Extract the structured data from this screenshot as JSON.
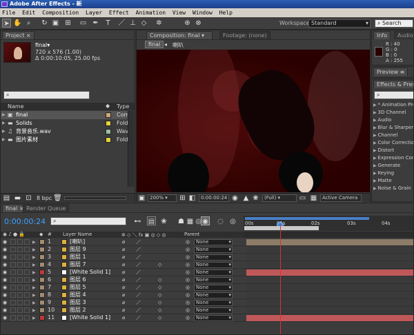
{
  "app": {
    "title": "Adobe After Effects - 新"
  },
  "menu": [
    "File",
    "Edit",
    "Composition",
    "Layer",
    "Effect",
    "Animation",
    "View",
    "Window",
    "Help"
  ],
  "toolbar": {
    "workspace_label": "Workspace:",
    "workspace_value": "Standard",
    "search_placeholder": "Search Help"
  },
  "project": {
    "tab_label": "Project",
    "comp_name": "final▾",
    "comp_size": "720 x 576 (1.00)",
    "comp_duration": "Δ 0:00:10:05, 25.00 fps",
    "search_value": "",
    "columns": {
      "name": "Name",
      "type": "Type"
    },
    "items": [
      {
        "name": "final",
        "type": "Com",
        "color": "#cfa87a",
        "icon": "composition-icon"
      },
      {
        "name": "Solids",
        "type": "Fold",
        "color": "#e6d23c",
        "icon": "folder-icon"
      },
      {
        "name": "背景音乐.wav",
        "type": "Wav",
        "color": "#9bbfa6",
        "icon": "audio-file-icon"
      },
      {
        "name": "图片素材",
        "type": "Fold",
        "color": "#e6d23c",
        "icon": "folder-icon"
      }
    ],
    "bpc": "8 bpc"
  },
  "composition": {
    "tab_label": "Composition: final",
    "footage_tab": "Footage: (none)",
    "breadcrumb": [
      "final",
      "喇叭"
    ],
    "zoom": "200%",
    "timecode": "0:00:00:24",
    "resolution": "(Full)",
    "camera": "Active Camera"
  },
  "info": {
    "tab_label": "Info",
    "audio_tab": "Audio",
    "r": "R : 40",
    "g": "G : 0",
    "b": "B : 0",
    "a": "A : 255",
    "color": "#280000"
  },
  "preview": {
    "tab_label": "Preview"
  },
  "effects": {
    "tab_label": "Effects & Presets",
    "search_value": "",
    "items": [
      "* Animation Presets",
      "3D Channel",
      "Audio",
      "Blur & Sharpen",
      "Channel",
      "Color Correction",
      "Distort",
      "Expression Controls",
      "Generate",
      "Keying",
      "Matte",
      "Noise & Grain"
    ]
  },
  "timeline": {
    "tab_label": "final",
    "render_tab": "Render Queue",
    "timecode": "0:00:00:24",
    "search_value": "",
    "columns": {
      "num": "#",
      "layer_name": "Layer Name",
      "parent": "Parent"
    },
    "ruler": [
      "00s",
      "01s",
      "02s",
      "03s",
      "04s"
    ],
    "layers": [
      {
        "num": "1",
        "name": "[喇叭]",
        "label_color": "#a58b6f",
        "parent": "None"
      },
      {
        "num": "2",
        "name": "图层 9",
        "label_color": "#a58b6f",
        "parent": "None"
      },
      {
        "num": "3",
        "name": "图层 1",
        "label_color": "#a58b6f",
        "parent": "None"
      },
      {
        "num": "4",
        "name": "图层 7",
        "label_color": "#a58b6f",
        "parent": "None"
      },
      {
        "num": "5",
        "name": "[White Solid 1]",
        "label_color": "#c0383a",
        "parent": "None"
      },
      {
        "num": "6",
        "name": "图层 6",
        "label_color": "#a58b6f",
        "parent": "None"
      },
      {
        "num": "7",
        "name": "图层 5",
        "label_color": "#a58b6f",
        "parent": "None"
      },
      {
        "num": "8",
        "name": "图层 4",
        "label_color": "#a58b6f",
        "parent": "None"
      },
      {
        "num": "9",
        "name": "图层 3",
        "label_color": "#a58b6f",
        "parent": "None"
      },
      {
        "num": "10",
        "name": "图层 2",
        "label_color": "#a58b6f",
        "parent": "None"
      },
      {
        "num": "11",
        "name": "[White Solid 1]",
        "label_color": "#c0383a",
        "parent": "None"
      }
    ]
  }
}
